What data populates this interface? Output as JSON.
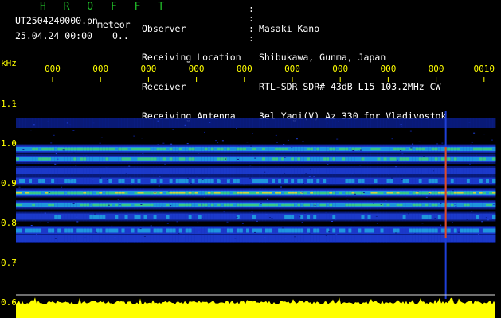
{
  "app": {
    "title": "H R O F F T",
    "filename": "UT2504240000.pn",
    "type": "meteor",
    "date": "25.04.24 00:00",
    "indicator": "0.."
  },
  "station": {
    "labels": [
      "Observer",
      "Receiving Location",
      "Receiver",
      "Receiving Antenna"
    ],
    "values": [
      "Masaki Kano",
      "Shibukawa, Gunma, Japan",
      "RTL-SDR SDR# 43dB L15 103.2MHz CW",
      "3el Yagi(V) Az 330 for Vladivostok"
    ]
  },
  "colors": {
    "title": "#22c22a",
    "label": "#ffffff",
    "axis": "#ffff00",
    "background": "#000000",
    "spectrum": "#ffff00"
  },
  "chart_data": {
    "type": "heatmap",
    "ylabel": "kHz",
    "y_ticks": [
      "1.1",
      "1.0",
      "0.9",
      "0.8",
      "0.7",
      "0.6"
    ],
    "ylim": [
      0.6,
      1.15
    ],
    "x_ticks": [
      "000",
      "000",
      "000",
      "000",
      "000",
      "000",
      "000",
      "000",
      "000",
      "0010"
    ],
    "bands_khz": [
      1.05,
      0.985,
      0.96,
      0.93,
      0.905,
      0.875,
      0.845,
      0.815,
      0.78,
      0.76
    ],
    "band_intensity": [
      0.15,
      0.75,
      0.7,
      0.35,
      0.45,
      0.9,
      0.75,
      0.4,
      0.5,
      0.35
    ],
    "meteor_trail_minute": 9.2,
    "grid": false
  }
}
